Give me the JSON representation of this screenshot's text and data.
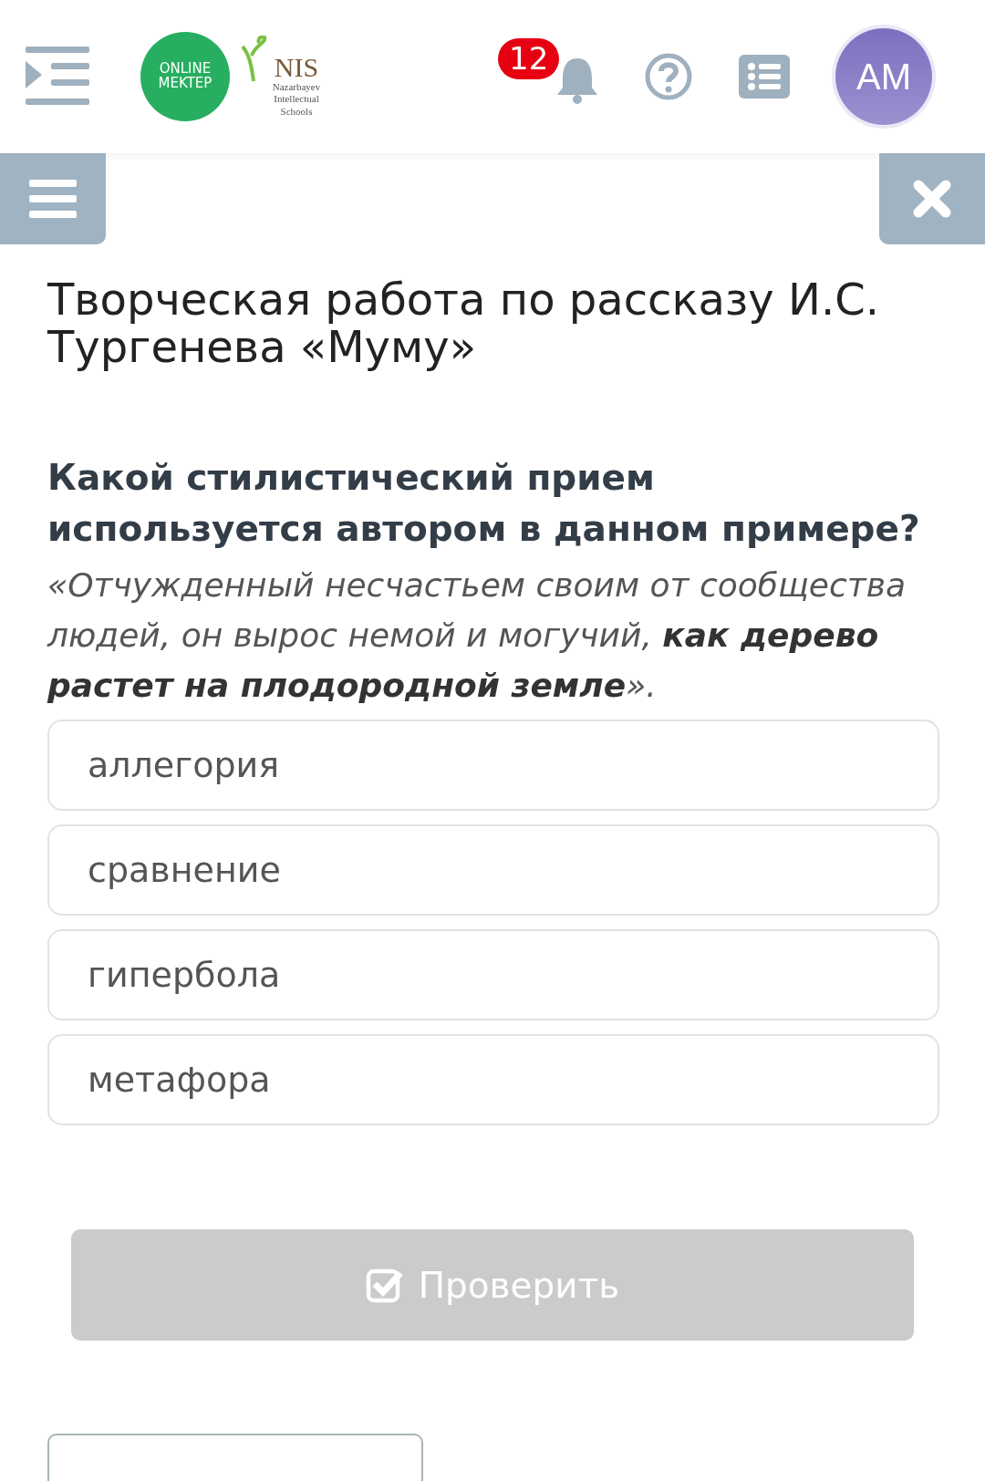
{
  "header": {
    "logo": {
      "circle_text": "ONLINE MEKTEP",
      "brand": "NIS",
      "subtitle": "Nazarbayev Intellectual Schools"
    },
    "notifications": {
      "count": "12"
    },
    "avatar": {
      "initials": "AM"
    }
  },
  "title": "Творческая работа по рассказу И.С. Тургенева «Муму»",
  "question": "Какой стилистический прием используется автором в данном примере?",
  "quote": "«Отчужденный несчастьем своим от сообщества людей, он вырос немой и могучий, **как дерево растет на плодородной земле**».",
  "options": [
    {
      "label": "аллегория",
      "selected": false
    },
    {
      "label": "сравнение",
      "selected": false
    },
    {
      "label": "гипербола",
      "selected": false
    },
    {
      "label": "метафора",
      "selected": false
    }
  ],
  "check_button": {
    "label": "Проверить",
    "disabled": true
  }
}
